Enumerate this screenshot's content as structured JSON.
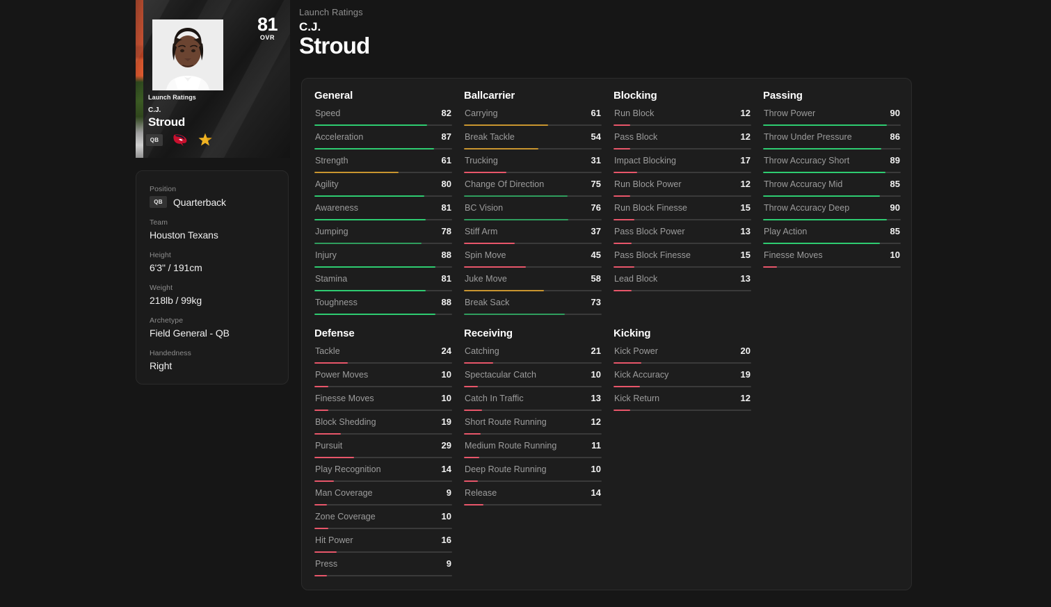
{
  "card": {
    "overall": "81",
    "overall_label": "OVR",
    "launch_label": "Launch Ratings",
    "first_name": "C.J.",
    "last_name": "Stroud",
    "position_chip": "QB",
    "team_logo_icon": "houston-texans-logo-icon",
    "star_icon": "star-icon"
  },
  "header": {
    "eyebrow": "Launch Ratings",
    "first_name": "C.J.",
    "last_name": "Stroud"
  },
  "info": {
    "rows": [
      {
        "label": "Position",
        "value": "Quarterback",
        "chip": "QB"
      },
      {
        "label": "Team",
        "value": "Houston Texans"
      },
      {
        "label": "Height",
        "value": "6'3\" / 191cm"
      },
      {
        "label": "Weight",
        "value": "218lb / 99kg"
      },
      {
        "label": "Archetype",
        "value": "Field General - QB"
      },
      {
        "label": "Handedness",
        "value": "Right"
      }
    ]
  },
  "colors": {
    "page_bg": "#161616",
    "panel_bg": "#1d1d1d",
    "high": "#2ecc71",
    "good": "#2f9e5e",
    "mid": "#c9952f",
    "low": "#e8566a",
    "track": "#3a3a3a"
  },
  "chart_data": {
    "type": "bar",
    "title": "C.J. Stroud Launch Ratings",
    "xlabel": "",
    "ylabel": "Rating",
    "ylim": [
      0,
      99
    ],
    "groups": [
      {
        "name": "General",
        "categories": [
          "Speed",
          "Acceleration",
          "Strength",
          "Agility",
          "Awareness",
          "Jumping",
          "Injury",
          "Stamina",
          "Toughness"
        ],
        "values": [
          82,
          87,
          61,
          80,
          81,
          78,
          88,
          81,
          88
        ]
      },
      {
        "name": "Ballcarrier",
        "categories": [
          "Carrying",
          "Break Tackle",
          "Trucking",
          "Change Of Direction",
          "BC Vision",
          "Stiff Arm",
          "Spin Move",
          "Juke Move",
          "Break Sack"
        ],
        "values": [
          61,
          54,
          31,
          75,
          76,
          37,
          45,
          58,
          73
        ]
      },
      {
        "name": "Blocking",
        "categories": [
          "Run Block",
          "Pass Block",
          "Impact Blocking",
          "Run Block Power",
          "Run Block Finesse",
          "Pass Block Power",
          "Pass Block Finesse",
          "Lead Block"
        ],
        "values": [
          12,
          12,
          17,
          12,
          15,
          13,
          15,
          13
        ]
      },
      {
        "name": "Passing",
        "categories": [
          "Throw Power",
          "Throw Under Pressure",
          "Throw Accuracy Short",
          "Throw Accuracy Mid",
          "Throw Accuracy Deep",
          "Play Action",
          "Finesse Moves"
        ],
        "values": [
          90,
          86,
          89,
          85,
          90,
          85,
          10
        ]
      },
      {
        "name": "Defense",
        "categories": [
          "Tackle",
          "Power Moves",
          "Finesse Moves",
          "Block Shedding",
          "Pursuit",
          "Play Recognition",
          "Man Coverage",
          "Zone Coverage",
          "Hit Power",
          "Press"
        ],
        "values": [
          24,
          10,
          10,
          19,
          29,
          14,
          9,
          10,
          16,
          9
        ]
      },
      {
        "name": "Receiving",
        "categories": [
          "Catching",
          "Spectacular Catch",
          "Catch In Traffic",
          "Short Route Running",
          "Medium Route Running",
          "Deep Route Running",
          "Release"
        ],
        "values": [
          21,
          10,
          13,
          12,
          11,
          10,
          14
        ]
      },
      {
        "name": "Kicking",
        "categories": [
          "Kick Power",
          "Kick Accuracy",
          "Kick Return"
        ],
        "values": [
          20,
          19,
          12
        ]
      }
    ]
  }
}
